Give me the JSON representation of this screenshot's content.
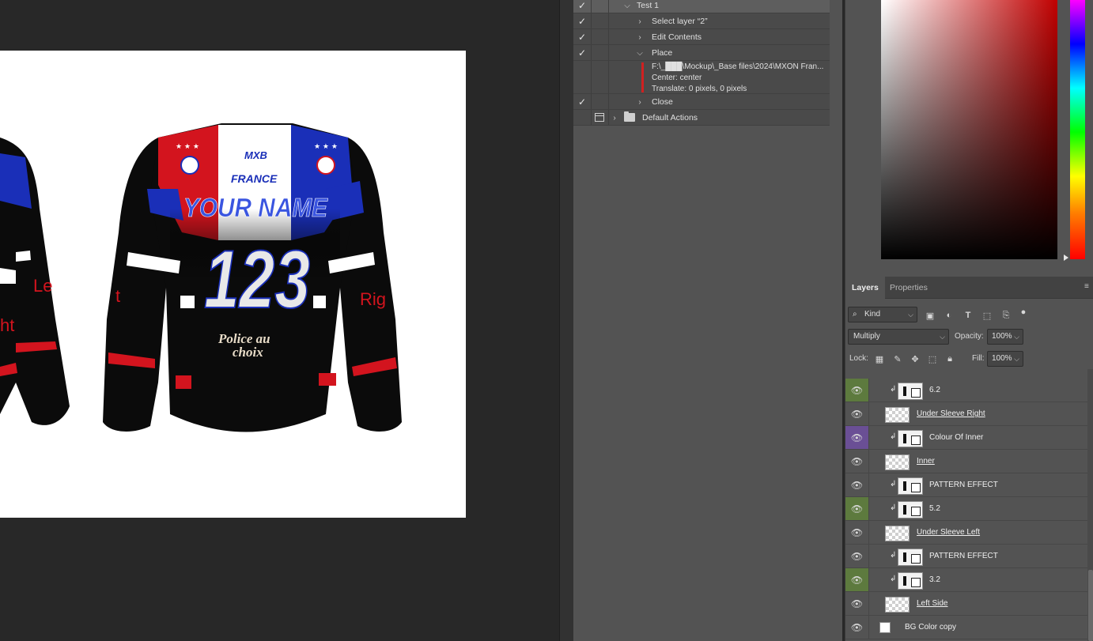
{
  "actions": {
    "rows": [
      {
        "label": "Test 1",
        "checked": true
      },
      {
        "label": "Select layer “2”",
        "checked": true
      },
      {
        "label": "Edit Contents",
        "checked": true
      },
      {
        "label": "Place",
        "checked": true
      },
      {
        "label": "Close",
        "checked": true
      },
      {
        "label": "Default Actions",
        "checked": false
      }
    ],
    "place_details": {
      "path": "F:\\_███\\Mockup\\_Base files\\2024\\MXON Fran...",
      "center": "Center: center",
      "translate": "Translate: 0 pixels, 0 pixels"
    },
    "icons": {
      "check": "checkmark-icon",
      "expanded": "chevron-down-icon",
      "collapsed": "chevron-right-icon",
      "set": "folder-icon"
    }
  },
  "canvas": {
    "jersey": {
      "name_text": "YOUR NAME",
      "number_text": "123",
      "country_text": "FRANCE",
      "logo_text": "MXB",
      "back_text_line1": "Police au",
      "back_text_line2": "choix",
      "left_jersey_text1": "Le",
      "left_jersey_text2": "ft",
      "left_jersey_text3": "ht",
      "sleeve_left_text": "t",
      "sleeve_right_text": "Rig",
      "colors": {
        "red": "#d3141e",
        "blue": "#1a2fb8",
        "black": "#0b0b0b",
        "white": "#ffffff"
      }
    }
  },
  "layers": {
    "tabs": [
      {
        "label": "Layers",
        "active": true
      },
      {
        "label": "Properties",
        "active": false
      }
    ],
    "filter": {
      "kind_label": "Kind"
    },
    "blend_mode": "Multiply",
    "opacity_label": "Opacity:",
    "opacity_value": "100%",
    "lock_label": "Lock:",
    "fill_label": "Fill:",
    "fill_value": "100%",
    "items": [
      {
        "name": "6.2",
        "eye": "green",
        "clipped": true,
        "type": "smart"
      },
      {
        "name": "Under Sleeve Right",
        "eye": "normal",
        "clipped": false,
        "type": "raster",
        "underline": true
      },
      {
        "name": "Colour Of Inner",
        "eye": "violet",
        "clipped": true,
        "type": "smart"
      },
      {
        "name": "Inner",
        "eye": "normal",
        "clipped": false,
        "type": "raster",
        "underline": true
      },
      {
        "name": "PATTERN EFFECT",
        "eye": "normal",
        "clipped": true,
        "type": "smart"
      },
      {
        "name": "5.2",
        "eye": "green",
        "clipped": true,
        "type": "smart"
      },
      {
        "name": "Under Sleeve Left",
        "eye": "normal",
        "clipped": false,
        "type": "raster",
        "underline": true
      },
      {
        "name": "PATTERN EFFECT",
        "eye": "normal",
        "clipped": true,
        "type": "smart"
      },
      {
        "name": "3.2",
        "eye": "green",
        "clipped": true,
        "type": "smart"
      },
      {
        "name": "Left Side",
        "eye": "normal",
        "clipped": false,
        "type": "raster",
        "underline": true
      },
      {
        "name": "BG Color copy",
        "eye": "normal",
        "clipped": false,
        "type": "fill"
      }
    ],
    "eye_colors": {
      "green": "#5d7a3e",
      "violet": "#6a4f95"
    }
  },
  "color_picker": {
    "hue_color": "#c00000"
  }
}
